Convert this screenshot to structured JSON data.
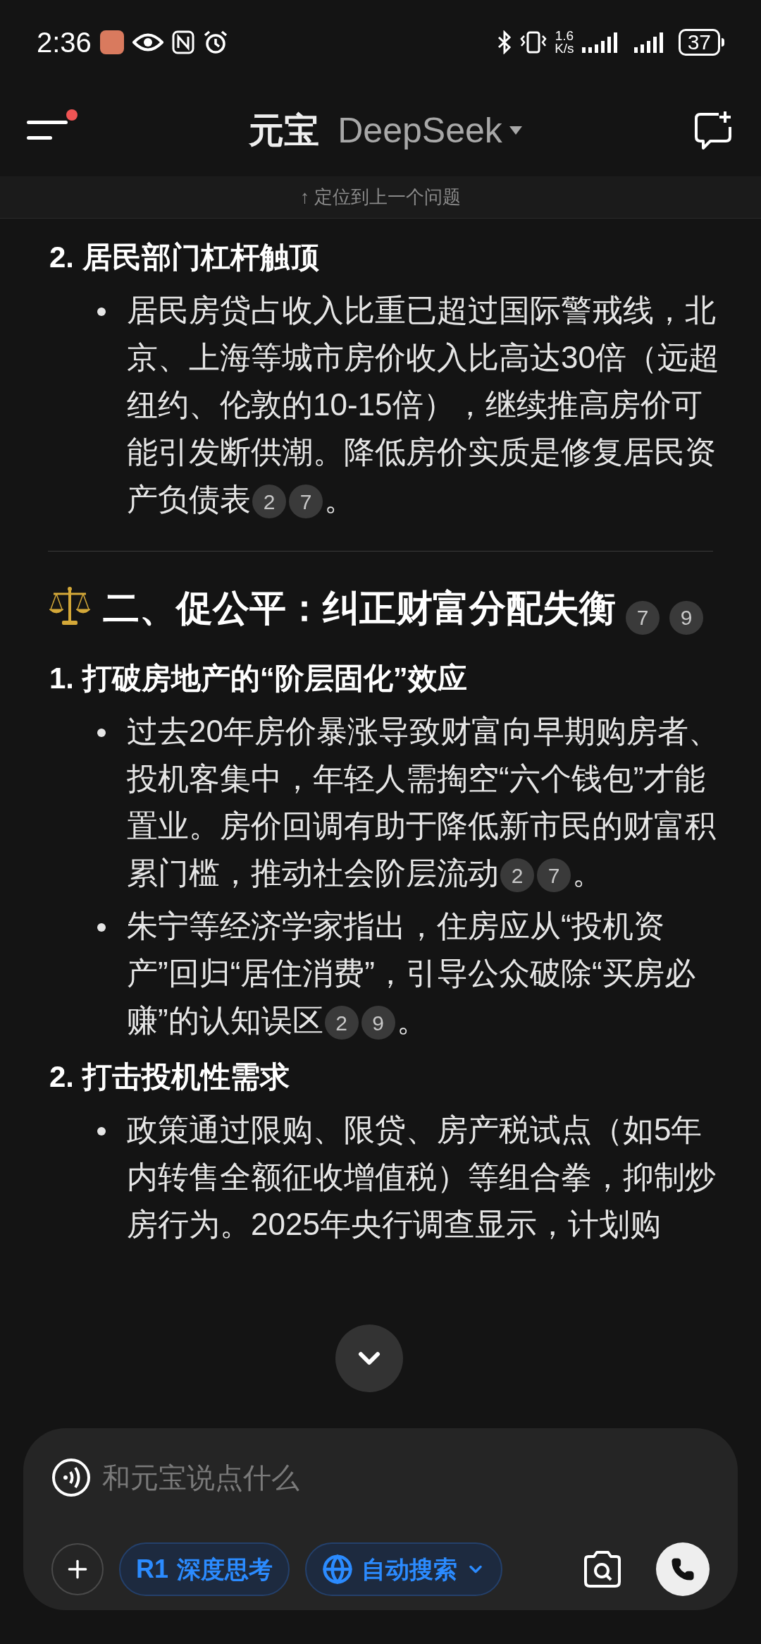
{
  "status_bar": {
    "time": "2:36",
    "speed_value": "1.6",
    "speed_unit": "K/s",
    "battery": "37"
  },
  "header": {
    "title": "元宝",
    "model": "DeepSeek",
    "has_notification": true
  },
  "jump_bar": {
    "label": "↑ 定位到上一个问题"
  },
  "content": [
    {
      "kind": "numbered",
      "number": "2.",
      "text": "居民部门杠杆触顶"
    },
    {
      "kind": "bullet",
      "text": "居民房贷占收入比重已超过国际警戒线，北京、上海等城市房价收入比高达30倍（远超纽约、伦敦的10-15倍），继续推高房价可能引发断供潮。降低房价实质是修复居民资产负债表",
      "citations": [
        "2",
        "7"
      ],
      "end": "。"
    },
    {
      "kind": "divider"
    },
    {
      "kind": "section",
      "text": "二、促公平：纠正财富分配失衡",
      "citations": [
        "7",
        "9"
      ]
    },
    {
      "kind": "numbered",
      "number": "1.",
      "text": "打破房地产的“阶层固化”效应"
    },
    {
      "kind": "bullet",
      "text": "过去20年房价暴涨导致财富向早期购房者、投机客集中，年轻人需掏空“六个钱包”才能置业。房价回调有助于降低新市民的财富积累门槛，推动社会阶层流动",
      "citations": [
        "2",
        "7"
      ],
      "end": "。"
    },
    {
      "kind": "bullet",
      "text": "朱宁等经济学家指出，住房应从“投机资产”回归“居住消费”，引导公众破除“买房必赚”的认知误区",
      "citations": [
        "2",
        "9"
      ],
      "end": "。"
    },
    {
      "kind": "numbered",
      "number": "2.",
      "text": "打击投机性需求"
    },
    {
      "kind": "bullet",
      "text": "政策通过限购、限贷、房产税试点（如5年内转售全额征收增值税）等组合拳，抑制炒房行为。2025年央行调查显示，计划购"
    }
  ],
  "composer": {
    "placeholder": "和元宝说点什么",
    "chips": [
      {
        "kind": "r1",
        "badge": "R1",
        "label": "深度思考",
        "selected": true
      },
      {
        "kind": "search",
        "label": "自动搜索",
        "selected": true
      }
    ]
  }
}
